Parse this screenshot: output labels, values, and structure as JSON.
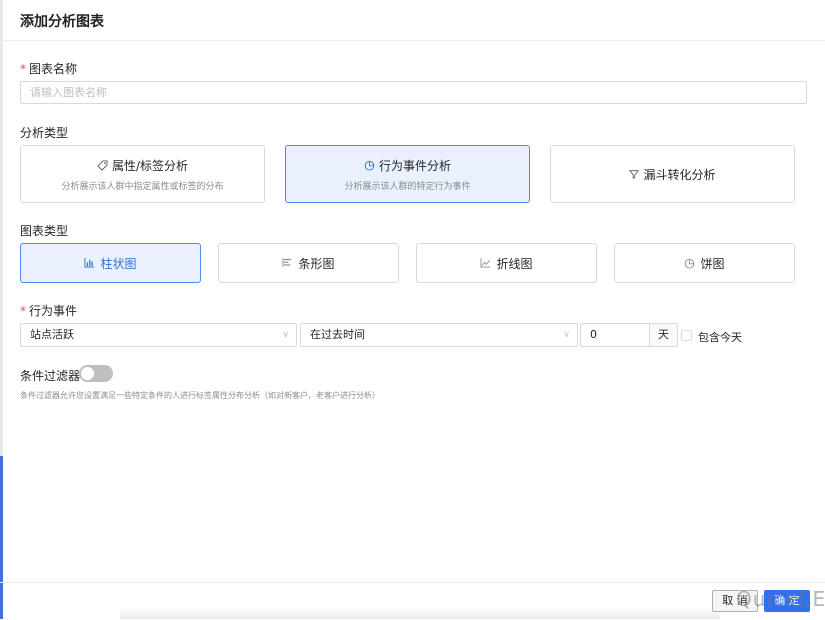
{
  "dialog": {
    "title": "添加分析图表"
  },
  "chart_name": {
    "label": "图表名称",
    "required_mark": "*",
    "placeholder": "请输入图表名称",
    "value": ""
  },
  "analysis_type": {
    "label": "分析类型",
    "options": [
      {
        "title": "属性/标签分析",
        "desc": "分析展示该人群中指定属性或标签的分布",
        "icon": "tag-icon",
        "selected": false
      },
      {
        "title": "行为事件分析",
        "desc": "分析展示该人群的特定行为事件",
        "icon": "pie-chart-icon",
        "selected": true
      },
      {
        "title": "漏斗转化分析",
        "desc": "",
        "icon": "funnel-icon",
        "selected": false
      }
    ]
  },
  "chart_type": {
    "label": "图表类型",
    "options": [
      {
        "label": "柱状图",
        "icon": "bar-chart-icon",
        "selected": true
      },
      {
        "label": "条形图",
        "icon": "bar-list-icon",
        "selected": false
      },
      {
        "label": "折线图",
        "icon": "line-chart-icon",
        "selected": false
      },
      {
        "label": "饼图",
        "icon": "pie-chart-icon",
        "selected": false
      }
    ]
  },
  "behavior_event": {
    "label": "行为事件",
    "required_mark": "*",
    "event_select": "站点活跃",
    "time_select": "在过去时间",
    "days_value": "0",
    "days_unit": "天",
    "include_today_label": "包含今天"
  },
  "filter": {
    "label": "条件过滤器",
    "enabled": false,
    "hint": "条件过滤器允许您设置满足一些特定条件的人进行标签属性分布分析（如对新客户、老客户进行分析）"
  },
  "footer": {
    "cancel_label": "取 消",
    "ok_label": "确 定"
  },
  "watermark": "QuickCEP",
  "colors": {
    "accent": "#2f6ff0",
    "selected_bg": "#e8f1fd",
    "required": "#ff4d4f"
  }
}
